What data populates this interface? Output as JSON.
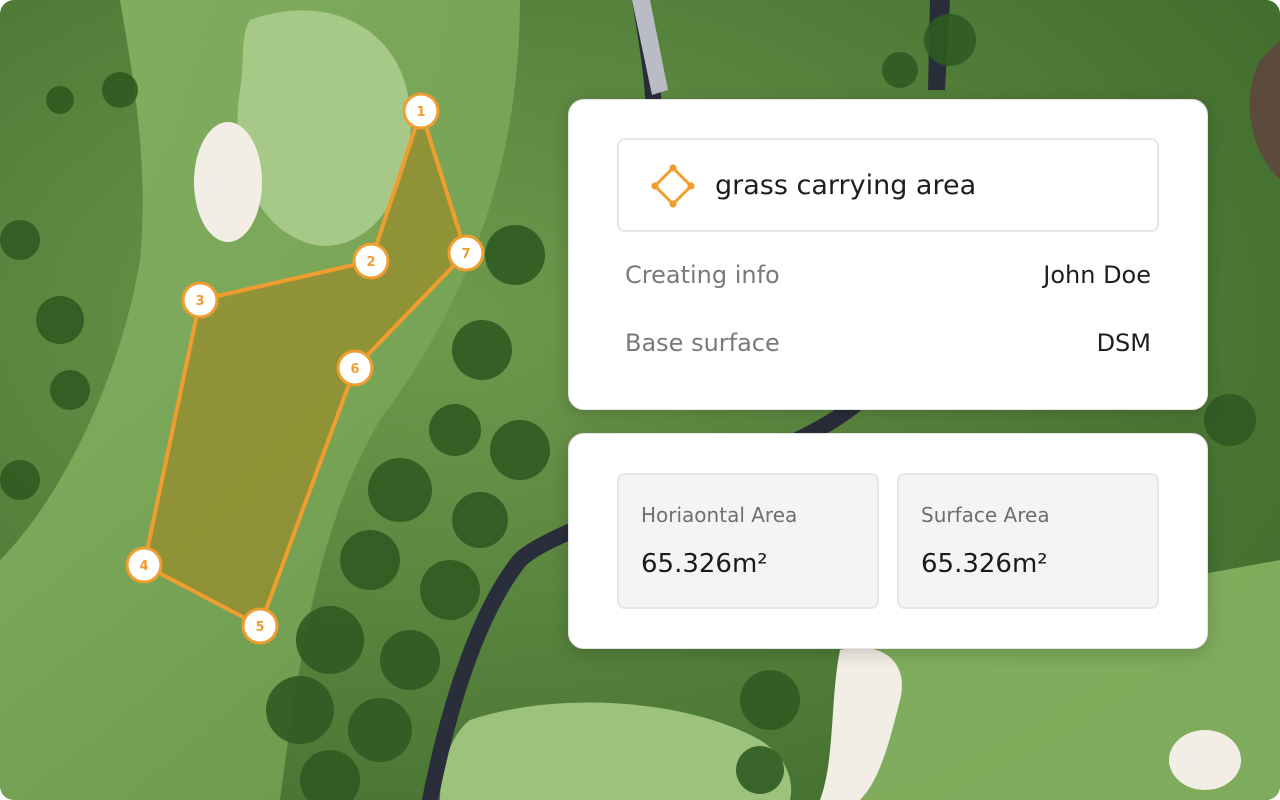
{
  "colors": {
    "accent": "#EF9D2E",
    "grass_light": "#7fa85a",
    "grass_dark": "#3f6e2c",
    "polygon_fill": "#9a8a2a",
    "path": "#2a2d3a",
    "bunker": "#f2eee6"
  },
  "map": {
    "vertices": [
      {
        "label": "1"
      },
      {
        "label": "2"
      },
      {
        "label": "3"
      },
      {
        "label": "4"
      },
      {
        "label": "5"
      },
      {
        "label": "6"
      },
      {
        "label": "7"
      }
    ]
  },
  "info_panel": {
    "shape_icon": "polygon-diamond-icon",
    "name": "grass carrying area",
    "rows": [
      {
        "key": "Creating info",
        "value": "John Doe"
      },
      {
        "key": "Base surface",
        "value": "DSM"
      }
    ]
  },
  "area_panel": {
    "metrics": [
      {
        "label": "Horiaontal Area",
        "value": "65.326m²"
      },
      {
        "label": "Surface Area",
        "value": "65.326m²"
      }
    ]
  }
}
